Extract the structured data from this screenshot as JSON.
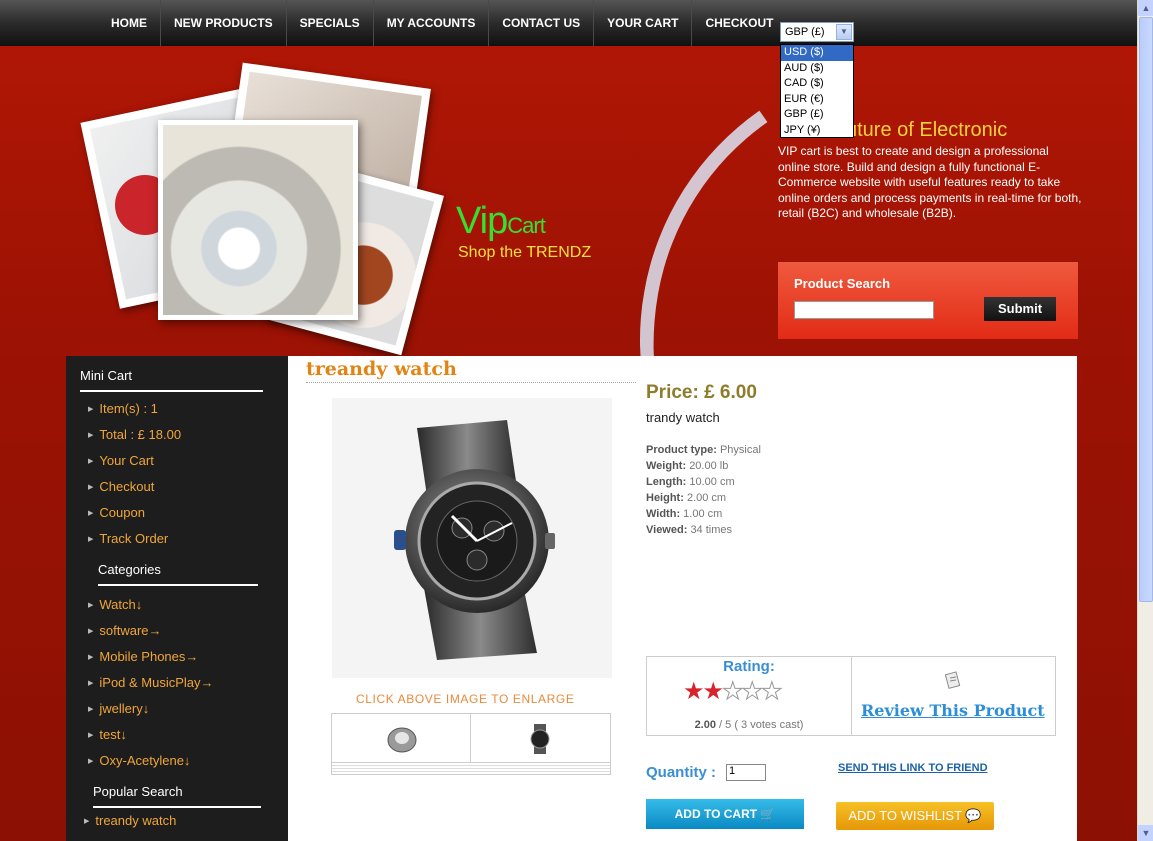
{
  "nav": {
    "items": [
      "HOME",
      "NEW PRODUCTS",
      "SPECIALS",
      "MY ACCOUNTS",
      "CONTACT US",
      "YOUR CART",
      "CHECKOUT"
    ]
  },
  "currency": {
    "selected": "GBP (£)",
    "options": [
      "USD ($)",
      "AUD ($)",
      "CAD ($)",
      "EUR (€)",
      "GBP (£)",
      "JPY (¥)"
    ],
    "highlighted_index": 0
  },
  "header": {
    "logo_main": "Vip",
    "logo_sub": "Cart",
    "tagline": "Shop the TRENDZ",
    "title_visible": "uture of Electronic",
    "description": "VIP cart is best to create and design a professional online store. Build and design a fully functional E-Commerce website with useful features ready to take online orders and process payments in real-time for both, retail (B2C) and wholesale (B2B)."
  },
  "search": {
    "label": "Product Search",
    "value": "",
    "submit_label": "Submit"
  },
  "sidebar": {
    "mini_cart_title": "Mini Cart",
    "mini_cart_items": [
      "Item(s) : 1",
      "Total : £ 18.00",
      "Your Cart",
      "Checkout",
      "Coupon",
      "Track Order"
    ],
    "categories_title": "Categories",
    "categories": [
      "Watch↓",
      "software→",
      "Mobile Phones→",
      "iPod & MusicPlay→",
      "jwellery↓",
      "test↓",
      "Oxy-Acetylene↓"
    ],
    "popular_title": "Popular Search",
    "popular": [
      "treandy watch"
    ]
  },
  "product": {
    "title": "treandy watch",
    "enlarge_text": "CLICK ABOVE IMAGE TO ENLARGE",
    "price": "Price: £ 6.00",
    "name": "trandy watch",
    "specs": [
      {
        "label": "Product type:",
        "value": "Physical"
      },
      {
        "label": "Weight:",
        "value": "20.00 lb"
      },
      {
        "label": "Length:",
        "value": "10.00 cm"
      },
      {
        "label": "Height:",
        "value": "2.00 cm"
      },
      {
        "label": "Width:",
        "value": "1.00 cm"
      },
      {
        "label": "Viewed:",
        "value": "34  times"
      }
    ],
    "rating_label": "Rating:",
    "rating_value": 2,
    "rating_max": 5,
    "rating_score": "2.00",
    "rating_suffix": "/ 5  ( 3 votes cast)",
    "review_link": "Review  This  Product",
    "quantity_label": "Quantity :",
    "quantity_value": "1",
    "send_link": "SEND THIS LINK TO FRIEND",
    "add_to_cart": "ADD TO CART",
    "add_to_wishlist": "ADD TO WISHLIST"
  },
  "colors": {
    "header_red": "#b31705",
    "accent_orange": "#e28313",
    "link_blue": "#2c8ed9",
    "price_olive": "#8e7c2b"
  }
}
